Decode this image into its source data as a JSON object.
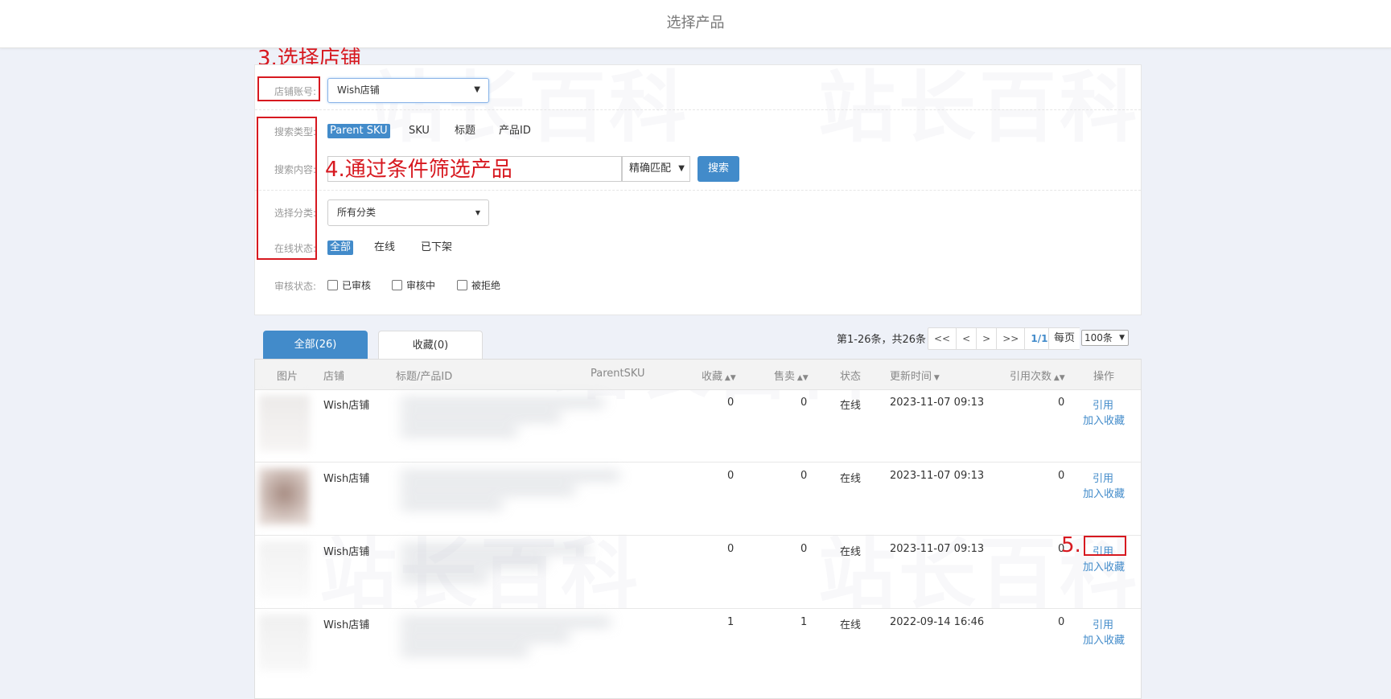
{
  "page": {
    "title": "选择产品"
  },
  "annotations": {
    "step3": "3.选择店铺",
    "step4": "4.通过条件筛选产品",
    "step5": "5."
  },
  "filters": {
    "store_label": "店铺账号:",
    "store_value": "Wish店铺",
    "search_type_label": "搜索类型:",
    "search_types": [
      "Parent SKU",
      "SKU",
      "标题",
      "产品ID"
    ],
    "search_content_label": "搜索内容:",
    "match_value": "精确匹配",
    "search_button": "搜索",
    "category_label": "选择分类:",
    "category_value": "所有分类",
    "online_label": "在线状态:",
    "online_options": [
      "全部",
      "在线",
      "已下架"
    ],
    "review_label": "审核状态:",
    "review_options": [
      "已审核",
      "审核中",
      "被拒绝"
    ]
  },
  "tabs": {
    "all": "全部(26)",
    "favorites": "收藏(0)"
  },
  "pagination": {
    "info": "第1-26条，共26条",
    "first": "<<",
    "prev": "<",
    "next": ">",
    "last": ">>",
    "current": "1/1",
    "per_page_label": "每页",
    "per_page_value": "100条"
  },
  "table": {
    "headers": {
      "image": "图片",
      "store": "店铺",
      "title": "标题/产品ID",
      "parent_sku": "ParentSKU",
      "favorites": "收藏",
      "sales": "售卖",
      "status": "状态",
      "updated": "更新时间",
      "references": "引用次数",
      "actions": "操作"
    },
    "rows": [
      {
        "store": "Wish店铺",
        "favorites": "0",
        "sales": "0",
        "status": "在线",
        "updated": "2023-11-07 09:13",
        "references": "0",
        "action_ref": "引用",
        "action_fav": "加入收藏"
      },
      {
        "store": "Wish店铺",
        "favorites": "0",
        "sales": "0",
        "status": "在线",
        "updated": "2023-11-07 09:13",
        "references": "0",
        "action_ref": "引用",
        "action_fav": "加入收藏"
      },
      {
        "store": "Wish店铺",
        "favorites": "0",
        "sales": "0",
        "status": "在线",
        "updated": "2023-11-07 09:13",
        "references": "0",
        "action_ref": "引用",
        "action_fav": "加入收藏"
      },
      {
        "store": "Wish店铺",
        "favorites": "1",
        "sales": "1",
        "status": "在线",
        "updated": "2022-09-14 16:46",
        "references": "0",
        "action_ref": "引用",
        "action_fav": "加入收藏"
      }
    ]
  },
  "colors": {
    "accent": "#428bca",
    "annotation_red": "#d71920",
    "background": "#eef1f8"
  }
}
